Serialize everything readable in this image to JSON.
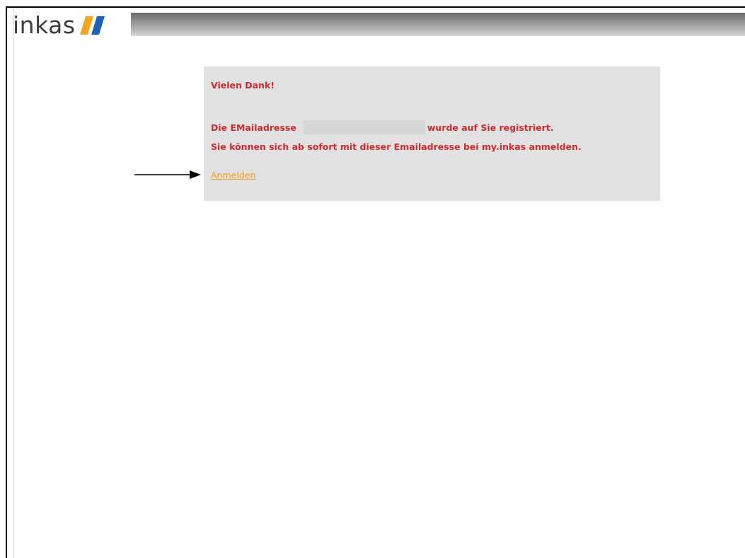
{
  "brand": {
    "logo_text": "inkas",
    "logo_mark_colors": [
      "#f5a51d",
      "#1d63b8"
    ]
  },
  "confirmation": {
    "heading": "Vielen Dank!",
    "email_prefix": "Die EMailadresse",
    "email_suffix": "wurde auf Sie registriert.",
    "info": "Sie können sich ab sofort mit dieser Emailadresse bei my.inkas anmelden.",
    "login_link": "Anmelden"
  },
  "colors": {
    "message_text": "#d02b2f",
    "link": "#f0a020",
    "panel_background": "#e1e1e1"
  }
}
